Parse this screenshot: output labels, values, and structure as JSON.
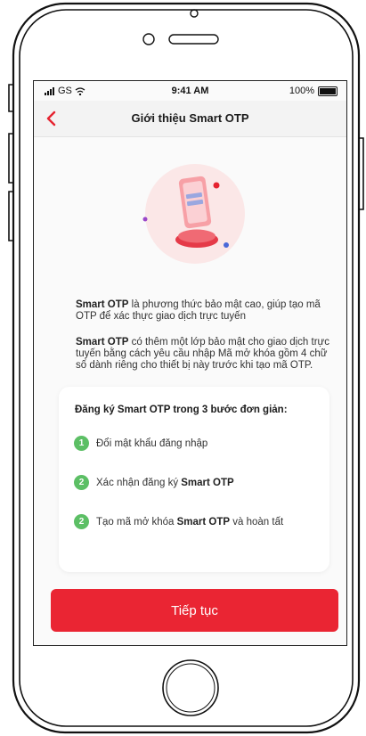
{
  "status_bar": {
    "carrier": "GS",
    "time": "9:41 AM",
    "battery": "100%"
  },
  "nav": {
    "title": "Giới thiệu Smart OTP"
  },
  "intro": [
    {
      "bold": "Smart OTP",
      "text": " là phương thức bảo mật cao, giúp tạo mã OTP để xác thực giao dịch trực tuyến"
    },
    {
      "bold": "Smart OTP",
      "text": " có thêm một lớp bảo mật cho giao dịch trực tuyến bằng cách yêu cầu nhập Mã mở khóa gồm 4 chữ số dành riêng cho thiết bị này trước khi tạo mã OTP."
    }
  ],
  "steps": {
    "title": "Đăng ký Smart OTP trong 3 bước đơn giản:",
    "items": [
      {
        "num": "1",
        "prefix": "Đổi mật khẩu đăng nhập",
        "bold": "",
        "suffix": ""
      },
      {
        "num": "2",
        "prefix": "Xác nhận đăng ký ",
        "bold": "Smart OTP",
        "suffix": ""
      },
      {
        "num": "2",
        "prefix": "Tạo mã mở khóa ",
        "bold": "Smart OTP",
        "suffix": " và hoàn tất"
      }
    ]
  },
  "cta": {
    "label": "Tiếp tục"
  },
  "colors": {
    "accent": "#ea2533",
    "step_badge": "#5cbf65"
  }
}
